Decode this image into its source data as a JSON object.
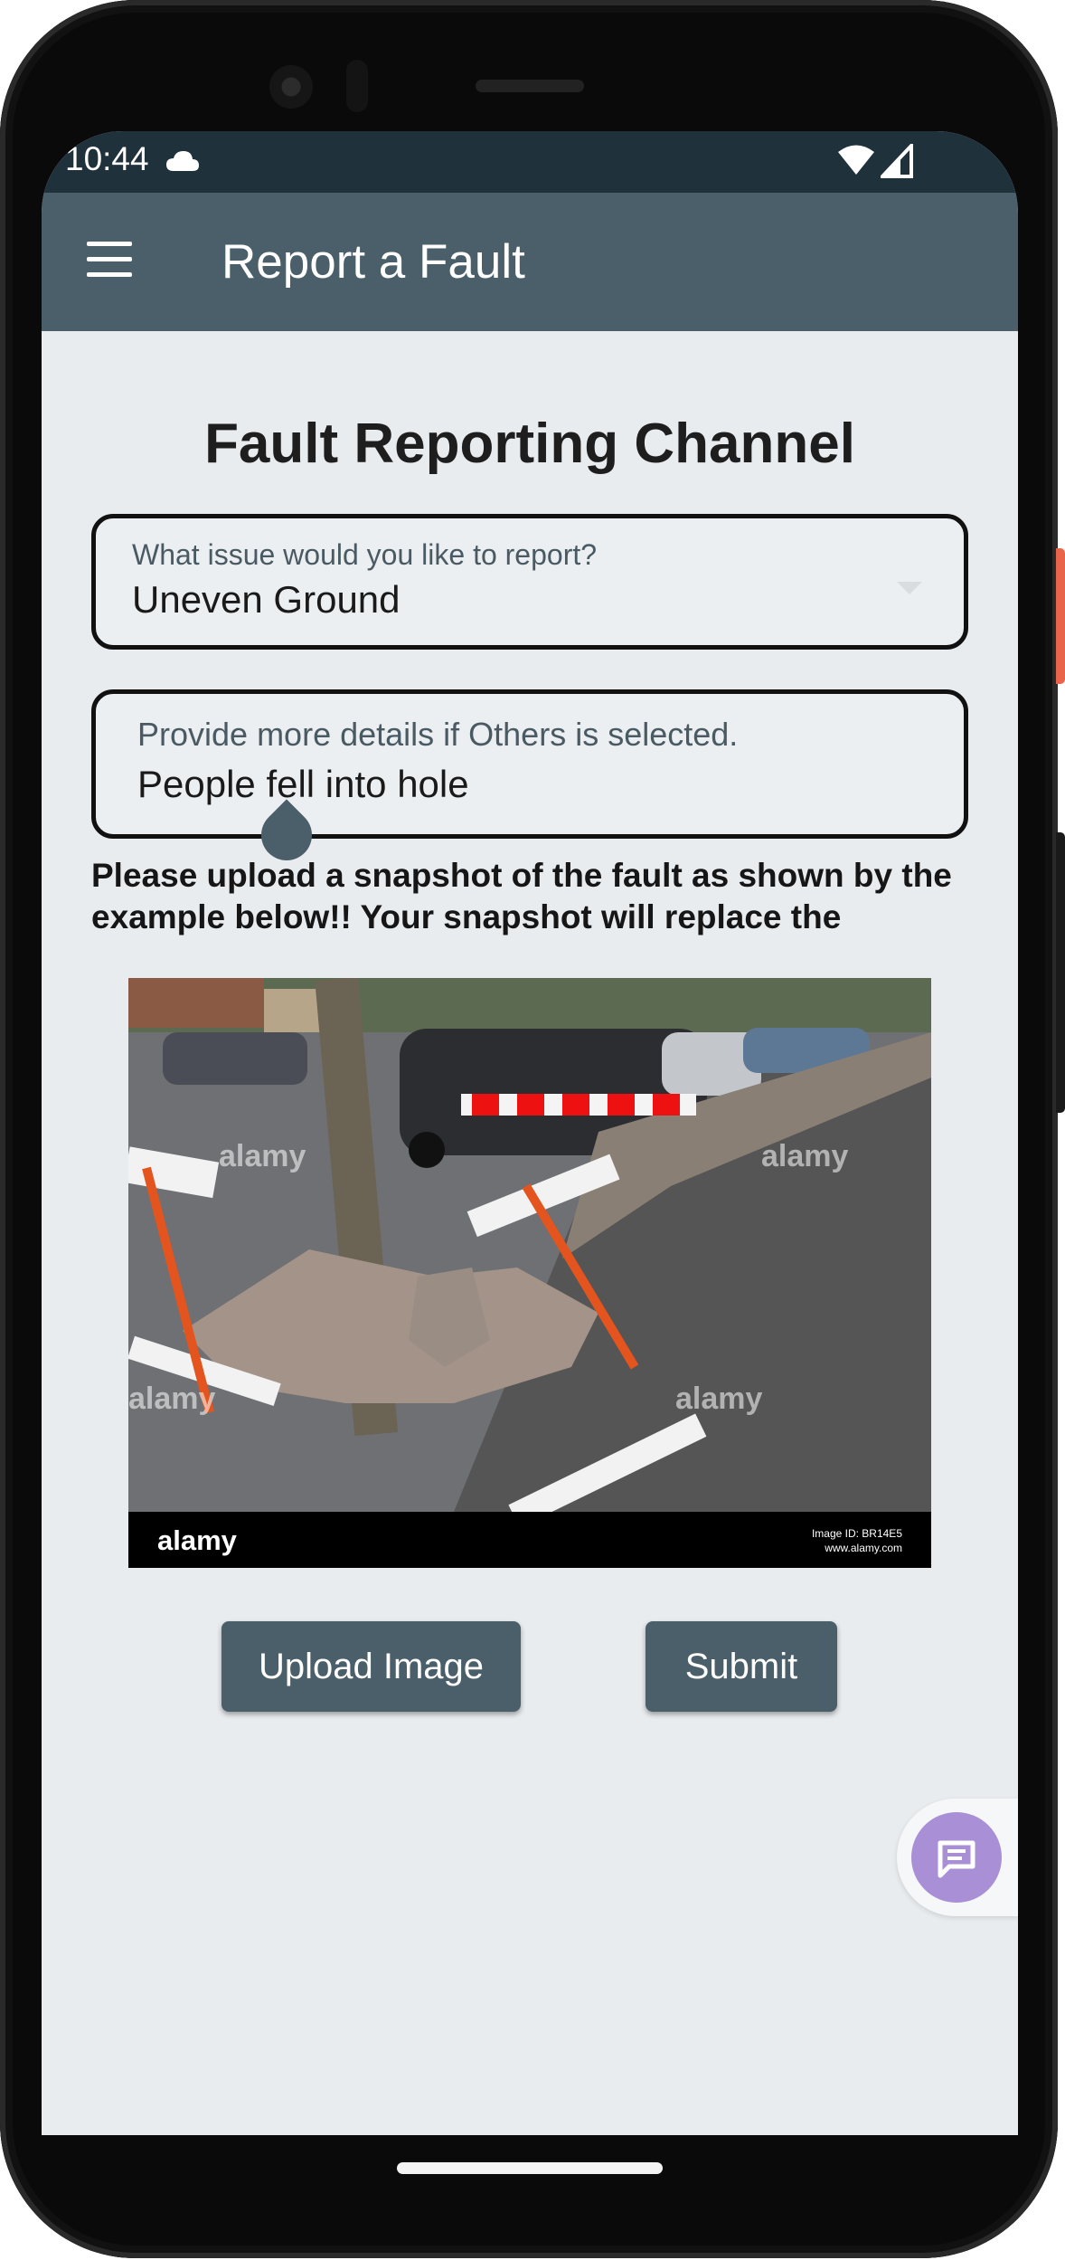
{
  "status_bar": {
    "time": "10:44",
    "icons": [
      "cloud-icon",
      "wifi-icon",
      "signal-icon"
    ]
  },
  "app_bar": {
    "title": "Report a Fault",
    "menu_icon": "menu-icon"
  },
  "page": {
    "title": "Fault Reporting Channel"
  },
  "issue_field": {
    "label": "What issue would you like to report?",
    "value": "Uneven Ground"
  },
  "details_field": {
    "label": "Provide more details if Others is selected.",
    "value": "People fell into hole"
  },
  "instructions": "Please upload a snapshot of the fault as shown by the example below!! Your snapshot will replace the",
  "example_image": {
    "watermark": "alamy",
    "footer_brand": "alamy",
    "image_id": "Image ID: BR14E5",
    "url": "www.alamy.com"
  },
  "buttons": {
    "upload": "Upload Image",
    "submit": "Submit"
  },
  "fab": {
    "icon": "chat-icon"
  },
  "colors": {
    "app_bar": "#4a5f6a",
    "status_bar": "#1f313b",
    "background": "#e9ecef",
    "button": "#4a5f6a",
    "fab": "#a98fd6"
  }
}
